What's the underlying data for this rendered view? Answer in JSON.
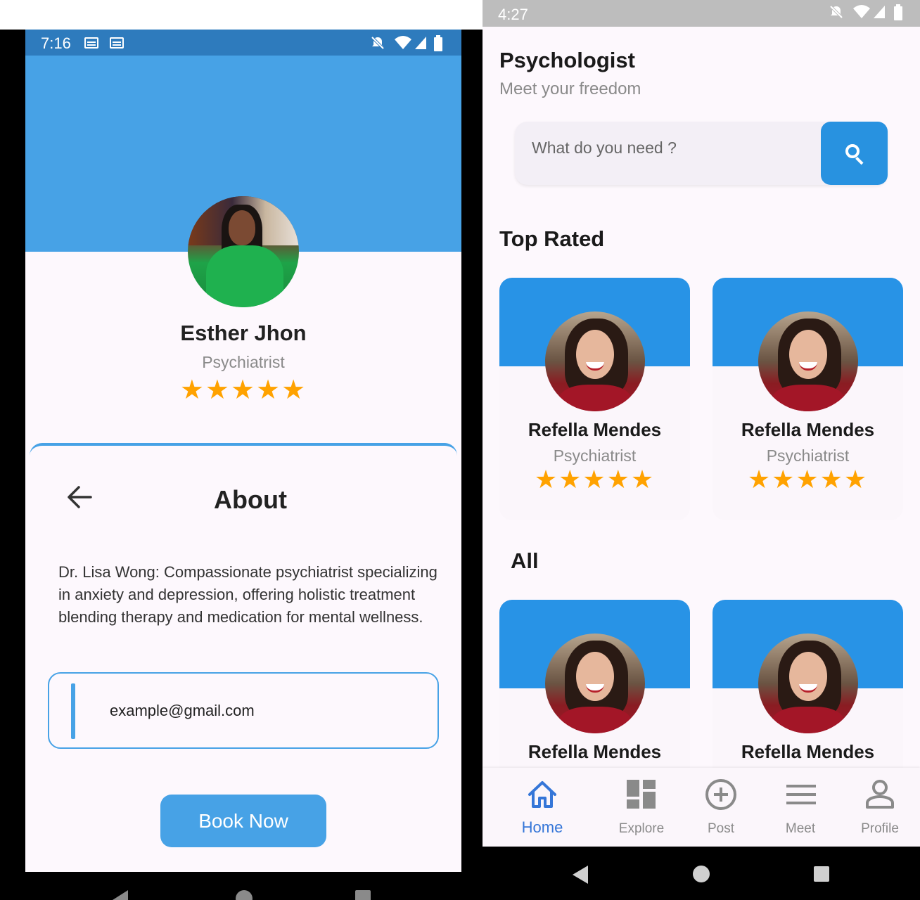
{
  "left": {
    "status": {
      "time": "7:16"
    },
    "profile": {
      "name": "Esther Jhon",
      "role": "Psychiatrist",
      "stars": "★★★★★",
      "rating": 5
    },
    "about": {
      "title": "About",
      "description": "Dr. Lisa Wong: Compassionate psychiatrist specializing in anxiety and depression, offering holistic treatment blending therapy and medication for mental wellness."
    },
    "email_input": {
      "value": "example@gmail.com"
    },
    "book_button": "Book Now",
    "accent_color": "#47a2e6"
  },
  "right": {
    "status": {
      "time": "4:27"
    },
    "header": {
      "title": "Psychologist",
      "subtitle": "Meet your freedom"
    },
    "search": {
      "placeholder": "What do you need ?"
    },
    "sections": {
      "top_rated": "Top Rated",
      "all": "All"
    },
    "top_rated": [
      {
        "name": "Refella Mendes",
        "role": "Psychiatrist",
        "stars": "★★★★★",
        "rating": 5
      },
      {
        "name": "Refella Mendes",
        "role": "Psychiatrist",
        "stars": "★★★★★",
        "rating": 5
      }
    ],
    "all": [
      {
        "name": "Refella Mendes"
      },
      {
        "name": "Refella Mendes"
      }
    ],
    "bottom_nav": [
      {
        "label": "Home",
        "icon": "home-icon",
        "active": true
      },
      {
        "label": "Explore",
        "icon": "dashboard-icon",
        "active": false
      },
      {
        "label": "Post",
        "icon": "add-circle-icon",
        "active": false
      },
      {
        "label": "Meet",
        "icon": "menu-icon",
        "active": false
      },
      {
        "label": "Profile",
        "icon": "person-icon",
        "active": false
      }
    ],
    "accent_color": "#2892e0",
    "active_tab_color": "#3576d8"
  }
}
